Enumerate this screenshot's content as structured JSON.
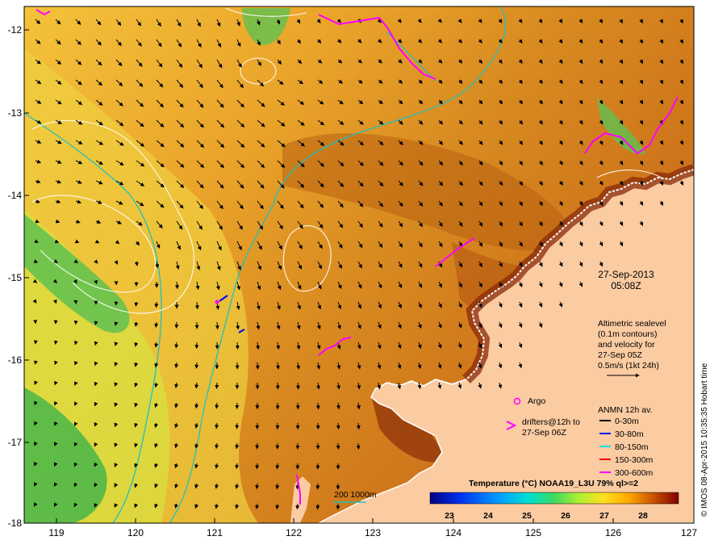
{
  "map": {
    "y_ticks": [
      "-12",
      "-13",
      "-14",
      "-15",
      "-16",
      "-17",
      "-18"
    ],
    "x_ticks": [
      "119",
      "120",
      "121",
      "122",
      "123",
      "124",
      "125",
      "126",
      "127"
    ],
    "date_line1": "27-Sep-2013",
    "date_line2": "05:08Z",
    "alti_lines": [
      "Altimetric sealevel",
      "(0.1m contours)",
      "and velocity for",
      "27-Sep 05Z",
      "0.5m/s (1kt 24h)"
    ],
    "argo_label": "Argo",
    "drifters_lines": [
      "drifters@12h to",
      "27-Sep 06Z"
    ],
    "anmn_title": "ANMN 12h av.",
    "anmn_items": [
      {
        "label": "0-30m",
        "color": "#000000"
      },
      {
        "label": "30-80m",
        "color": "#0000ff"
      },
      {
        "label": "80-150m",
        "color": "#00e0e0"
      },
      {
        "label": "150-300m",
        "color": "#ff0000"
      },
      {
        "label": "300-600m",
        "color": "#ff00ff"
      }
    ],
    "colorbar_title": "Temperature (°C) NOAA19_L3U 79% ql>=2",
    "colorbar_ticks": [
      "23",
      "24",
      "25",
      "26",
      "27",
      "28"
    ],
    "colorbar_colors": [
      "#000080",
      "#0010e0",
      "#0090ff",
      "#00e0e0",
      "#20d080",
      "#60e040",
      "#c0f030",
      "#ffe020",
      "#ffb000",
      "#e08000",
      "#b04000",
      "#800000"
    ],
    "isobath_label": "200  1000m",
    "credit": "© IMOS 08-Apr-2015 10:35:35 Hobart time",
    "colors": {
      "land": "#fbcba2",
      "isobath": "#20c0c0",
      "argo": "#ff00ff"
    }
  }
}
